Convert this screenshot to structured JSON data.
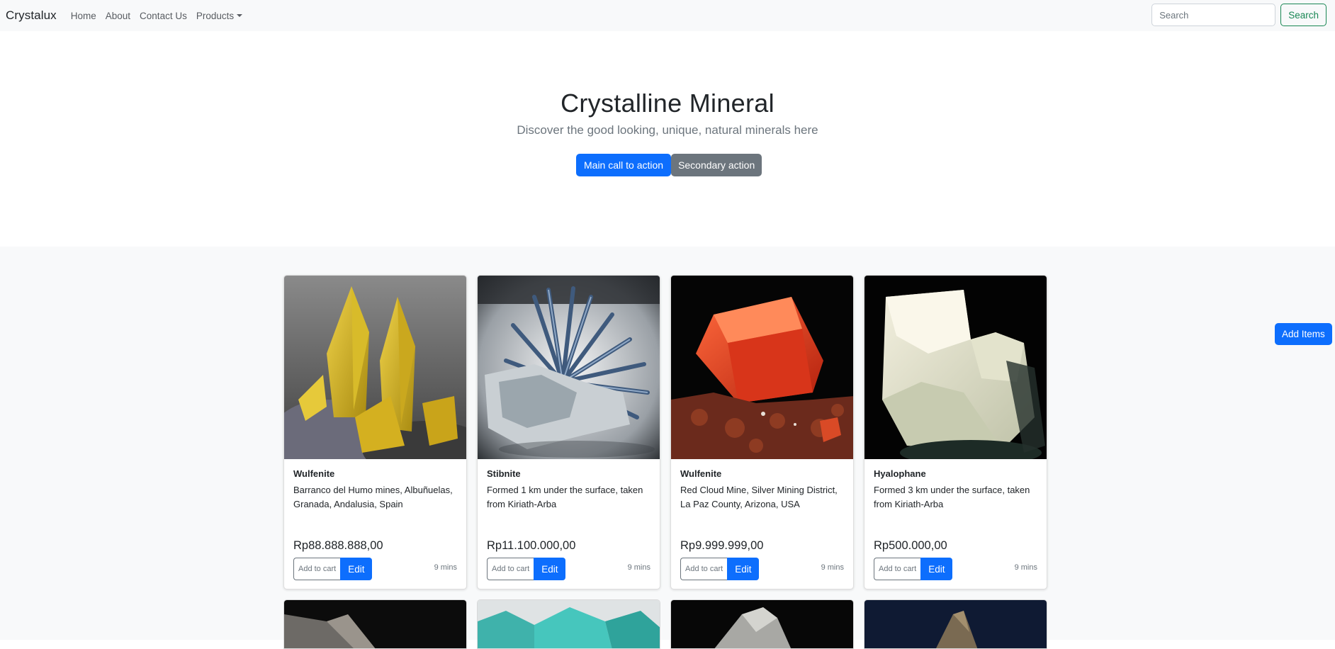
{
  "navbar": {
    "brand": "Crystalux",
    "links": [
      "Home",
      "About",
      "Contact Us"
    ],
    "dropdown_label": "Products",
    "search_placeholder": "Search",
    "search_button": "Search"
  },
  "hero": {
    "title": "Crystalline Mineral",
    "subtitle": "Discover the good looking, unique, natural minerals here",
    "primary_button": "Main call to action",
    "secondary_button": "Secondary action"
  },
  "cards": [
    {
      "name": "Wulfenite",
      "description": "Barranco del Humo mines, Albuñuelas, Granada, Andalusia, Spain",
      "price": "Rp88.888.888,00",
      "cart_label": "Add to cart",
      "edit_label": "Edit",
      "time": "9 mins",
      "image": "yellow-wulfenite-crystals"
    },
    {
      "name": "Stibnite",
      "description": "Formed 1 km under the surface, taken from Kiriath-Arba",
      "price": "Rp11.100.000,00",
      "cart_label": "Add to cart",
      "edit_label": "Edit",
      "time": "9 mins",
      "image": "blue-stibnite-spray"
    },
    {
      "name": "Wulfenite",
      "description": "Red Cloud Mine, Silver Mining District, La Paz County, Arizona, USA",
      "price": "Rp9.999.999,00",
      "cart_label": "Add to cart",
      "edit_label": "Edit",
      "time": "9 mins",
      "image": "red-wulfenite-crystal"
    },
    {
      "name": "Hyalophane",
      "description": "Formed 3 km under the surface, taken from Kiriath-Arba",
      "price": "Rp500.000,00",
      "cart_label": "Add to cart",
      "edit_label": "Edit",
      "time": "9 mins",
      "image": "clear-hyalophane-crystal"
    }
  ],
  "floating_button": "Add Items",
  "colors": {
    "primary": "#0d6efd",
    "secondary": "#6c757d",
    "success": "#198754",
    "navbar_bg": "#f8f9fa"
  }
}
